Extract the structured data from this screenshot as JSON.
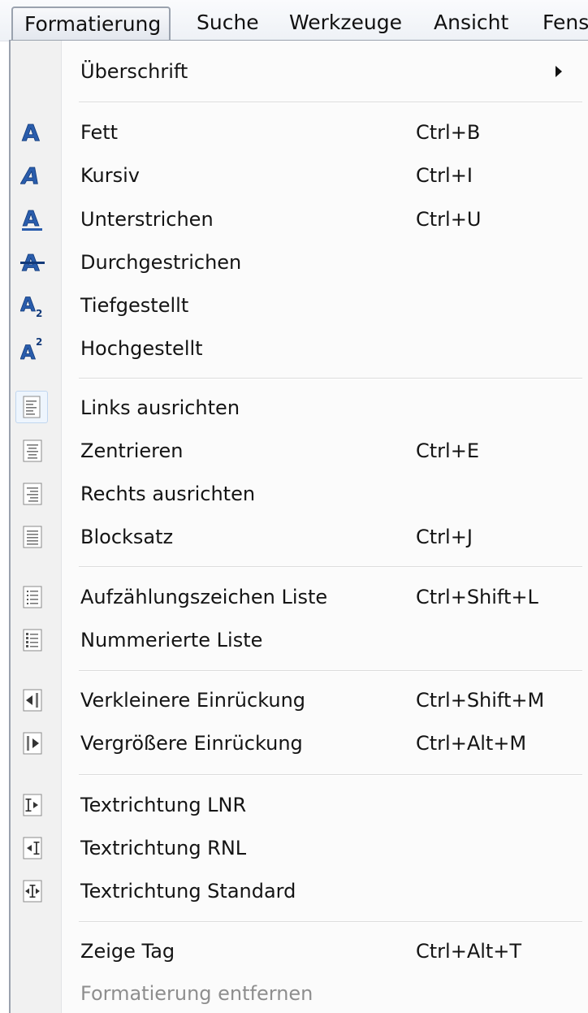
{
  "menubar": {
    "items": [
      {
        "label": "Formatierung"
      },
      {
        "label": "Suche"
      },
      {
        "label": "Werkzeuge"
      },
      {
        "label": "Ansicht"
      },
      {
        "label": "Fens"
      }
    ]
  },
  "menu": {
    "heading": {
      "label": "Überschrift",
      "has_submenu": true
    },
    "text_style": [
      {
        "label": "Fett",
        "shortcut": "Ctrl+B",
        "icon": "bold-icon"
      },
      {
        "label": "Kursiv",
        "shortcut": "Ctrl+I",
        "icon": "italic-icon"
      },
      {
        "label": "Unterstrichen",
        "shortcut": "Ctrl+U",
        "icon": "underline-icon"
      },
      {
        "label": "Durchgestrichen",
        "shortcut": "",
        "icon": "strikethrough-icon"
      },
      {
        "label": "Tiefgestellt",
        "shortcut": "",
        "icon": "subscript-icon",
        "icon_text": "2"
      },
      {
        "label": "Hochgestellt",
        "shortcut": "",
        "icon": "superscript-icon",
        "icon_text": "2"
      }
    ],
    "alignment": [
      {
        "label": "Links ausrichten",
        "shortcut": "",
        "icon": "align-left-icon"
      },
      {
        "label": "Zentrieren",
        "shortcut": "Ctrl+E",
        "icon": "align-center-icon"
      },
      {
        "label": "Rechts ausrichten",
        "shortcut": "",
        "icon": "align-right-icon"
      },
      {
        "label": "Blocksatz",
        "shortcut": "Ctrl+J",
        "icon": "align-justify-icon"
      }
    ],
    "lists": [
      {
        "label": "Aufzählungszeichen Liste",
        "shortcut": "Ctrl+Shift+L",
        "icon": "bullet-list-icon"
      },
      {
        "label": "Nummerierte Liste",
        "shortcut": "",
        "icon": "numbered-list-icon"
      }
    ],
    "indent": [
      {
        "label": "Verkleinere Einrückung",
        "shortcut": "Ctrl+Shift+M",
        "icon": "outdent-icon"
      },
      {
        "label": "Vergrößere Einrückung",
        "shortcut": "Ctrl+Alt+M",
        "icon": "indent-icon"
      }
    ],
    "direction": [
      {
        "label": "Textrichtung LNR",
        "shortcut": "",
        "icon": "text-direction-ltr-icon"
      },
      {
        "label": "Textrichtung RNL",
        "shortcut": "",
        "icon": "text-direction-rtl-icon"
      },
      {
        "label": "Textrichtung Standard",
        "shortcut": "",
        "icon": "text-direction-default-icon"
      }
    ],
    "tags": [
      {
        "label": "Zeige Tag",
        "shortcut": "Ctrl+Alt+T",
        "enabled": true
      },
      {
        "label": "Formatierung entfernen",
        "shortcut": "",
        "enabled": false
      }
    ]
  },
  "colors": {
    "icon_blue": "#2a5dac",
    "disabled_text": "#8e8e8e",
    "menu_border": "#9aa2ae"
  }
}
